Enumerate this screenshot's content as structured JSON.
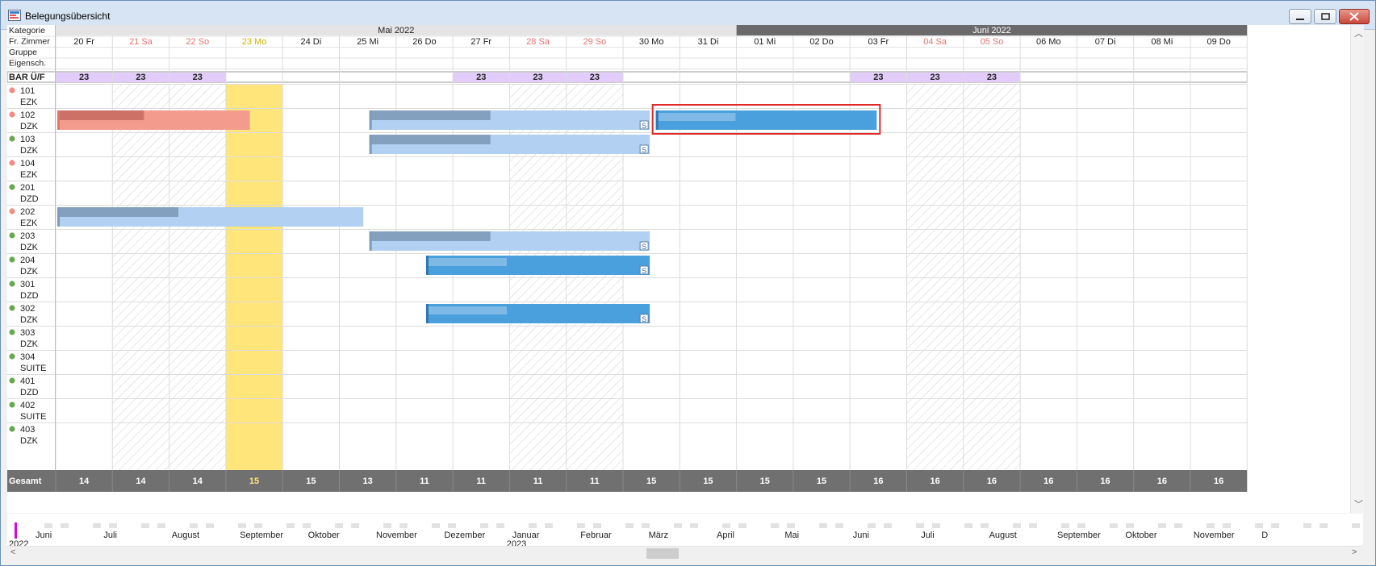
{
  "window": {
    "title": "Belegungsübersicht"
  },
  "colors": {
    "weekend": "#e8726e",
    "holiday": "#c8b200",
    "highlight_day": "#ffe57a",
    "bar_light": "#b1d0f2",
    "bar_dark": "#4aa0dc",
    "bar_red": "#f39b8d",
    "bar_edge": "#7e9ab8",
    "dot_green": "#6aa84f",
    "dot_red": "#f08d84",
    "gesamt_bg": "#707070",
    "month2_bg": "#6a6a6a",
    "purple": "#e2ccf9",
    "selection": "#e02a2a"
  },
  "header": {
    "row_labels": [
      "Kategorie",
      "Fr. Zimmer",
      "Gruppe",
      "Eigensch."
    ],
    "months": [
      {
        "label": "Mai 2022",
        "start": 0,
        "span": 12
      },
      {
        "label": "Juni 2022",
        "start": 12,
        "span": 9
      }
    ],
    "days": [
      {
        "label": "20 Fr",
        "kind": "normal"
      },
      {
        "label": "21 Sa",
        "kind": "weekend"
      },
      {
        "label": "22 So",
        "kind": "weekend"
      },
      {
        "label": "23 Mo",
        "kind": "holiday"
      },
      {
        "label": "24 Di",
        "kind": "normal"
      },
      {
        "label": "25 Mi",
        "kind": "normal"
      },
      {
        "label": "26 Do",
        "kind": "normal"
      },
      {
        "label": "27 Fr",
        "kind": "normal"
      },
      {
        "label": "28 Sa",
        "kind": "weekend"
      },
      {
        "label": "29 So",
        "kind": "weekend"
      },
      {
        "label": "30 Mo",
        "kind": "normal"
      },
      {
        "label": "31 Di",
        "kind": "normal"
      },
      {
        "label": "01 Mi",
        "kind": "normal"
      },
      {
        "label": "02 Do",
        "kind": "normal"
      },
      {
        "label": "03 Fr",
        "kind": "normal"
      },
      {
        "label": "04 Sa",
        "kind": "weekend"
      },
      {
        "label": "05 So",
        "kind": "weekend"
      },
      {
        "label": "06 Mo",
        "kind": "normal"
      },
      {
        "label": "07 Di",
        "kind": "normal"
      },
      {
        "label": "08 Mi",
        "kind": "normal"
      },
      {
        "label": "09 Do",
        "kind": "normal"
      }
    ],
    "highlight_day": 3
  },
  "rate": {
    "label": "BAR Ü/F",
    "value": "23",
    "days": [
      0,
      1,
      2,
      7,
      8,
      9,
      14,
      15,
      16
    ]
  },
  "rooms": [
    {
      "number": "101",
      "category": "EZK",
      "status": "red"
    },
    {
      "number": "102",
      "category": "DZK",
      "status": "red"
    },
    {
      "number": "103",
      "category": "DZK",
      "status": "green"
    },
    {
      "number": "104",
      "category": "EZK",
      "status": "red"
    },
    {
      "number": "201",
      "category": "DZD",
      "status": "green"
    },
    {
      "number": "202",
      "category": "EZK",
      "status": "red"
    },
    {
      "number": "203",
      "category": "DZK",
      "status": "green"
    },
    {
      "number": "204",
      "category": "DZK",
      "status": "green"
    },
    {
      "number": "301",
      "category": "DZD",
      "status": "green"
    },
    {
      "number": "302",
      "category": "DZK",
      "status": "green"
    },
    {
      "number": "303",
      "category": "DZK",
      "status": "green"
    },
    {
      "number": "304",
      "category": "SUITE",
      "status": "green"
    },
    {
      "number": "401",
      "category": "DZD",
      "status": "green"
    },
    {
      "number": "402",
      "category": "SUITE",
      "status": "green"
    },
    {
      "number": "403",
      "category": "DZK",
      "status": "green"
    }
  ],
  "bookings": [
    {
      "room": 1,
      "start": 0,
      "end": 3.45,
      "style": "red",
      "flag": ""
    },
    {
      "room": 1,
      "start": 5.5,
      "end": 10.5,
      "style": "light",
      "flag": "S"
    },
    {
      "room": 1,
      "start": 10.55,
      "end": 14.5,
      "style": "dark",
      "flag": "",
      "selected": true
    },
    {
      "room": 2,
      "start": 5.5,
      "end": 10.5,
      "style": "light",
      "flag": "S"
    },
    {
      "room": 5,
      "start": 0,
      "end": 5.45,
      "style": "light",
      "flag": ""
    },
    {
      "room": 6,
      "start": 5.5,
      "end": 10.5,
      "style": "light",
      "flag": "S"
    },
    {
      "room": 7,
      "start": 6.5,
      "end": 10.5,
      "style": "dark",
      "flag": "S"
    },
    {
      "room": 9,
      "start": 6.5,
      "end": 10.5,
      "style": "dark",
      "flag": "S"
    }
  ],
  "totals": {
    "label": "Gesamt",
    "values": [
      "14",
      "14",
      "14",
      "15",
      "15",
      "13",
      "11",
      "11",
      "11",
      "11",
      "15",
      "15",
      "15",
      "15",
      "16",
      "16",
      "16",
      "16",
      "16",
      "16",
      "16"
    ]
  },
  "timeline": {
    "months": [
      "Juni",
      "Juli",
      "August",
      "September",
      "Oktober",
      "November",
      "Dezember",
      "Januar",
      "Februar",
      "März",
      "April",
      "Mai",
      "Juni",
      "Juli",
      "August",
      "September",
      "Oktober",
      "November",
      "D"
    ],
    "years": [
      {
        "label": "2022",
        "month": 0
      },
      {
        "label": "2023",
        "month": 7
      }
    ]
  }
}
